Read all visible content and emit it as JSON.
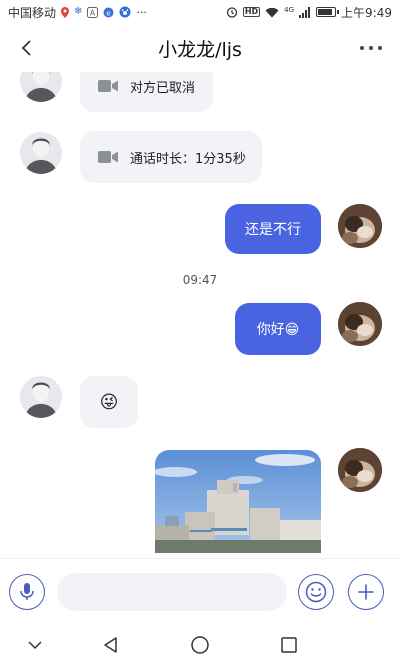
{
  "status_bar": {
    "carrier": "中国移动",
    "signal_label": "4G",
    "hd_label": "HD",
    "time": "上午9:49",
    "battery_level": 0.85
  },
  "header": {
    "title": "小龙龙/ljs"
  },
  "messages": {
    "m1": {
      "text": "对方已取消"
    },
    "m2": {
      "text": "通话时长：1分35秒"
    },
    "m3": {
      "text": "还是不行"
    },
    "timestamp": "09:47",
    "m4": {
      "text": "你好😁"
    },
    "m5": {
      "text": "😜"
    }
  },
  "input": {
    "placeholder": "",
    "value": ""
  },
  "colors": {
    "accent": "#4a63e0",
    "bubble_left": "#f2f3f7",
    "icon_outline": "#4a5cb8"
  },
  "icons": {
    "back": "back-arrow-icon",
    "more": "more-dots-icon",
    "video": "video-camera-icon",
    "mic": "microphone-icon",
    "emoji": "smiley-icon",
    "plus": "plus-icon"
  }
}
